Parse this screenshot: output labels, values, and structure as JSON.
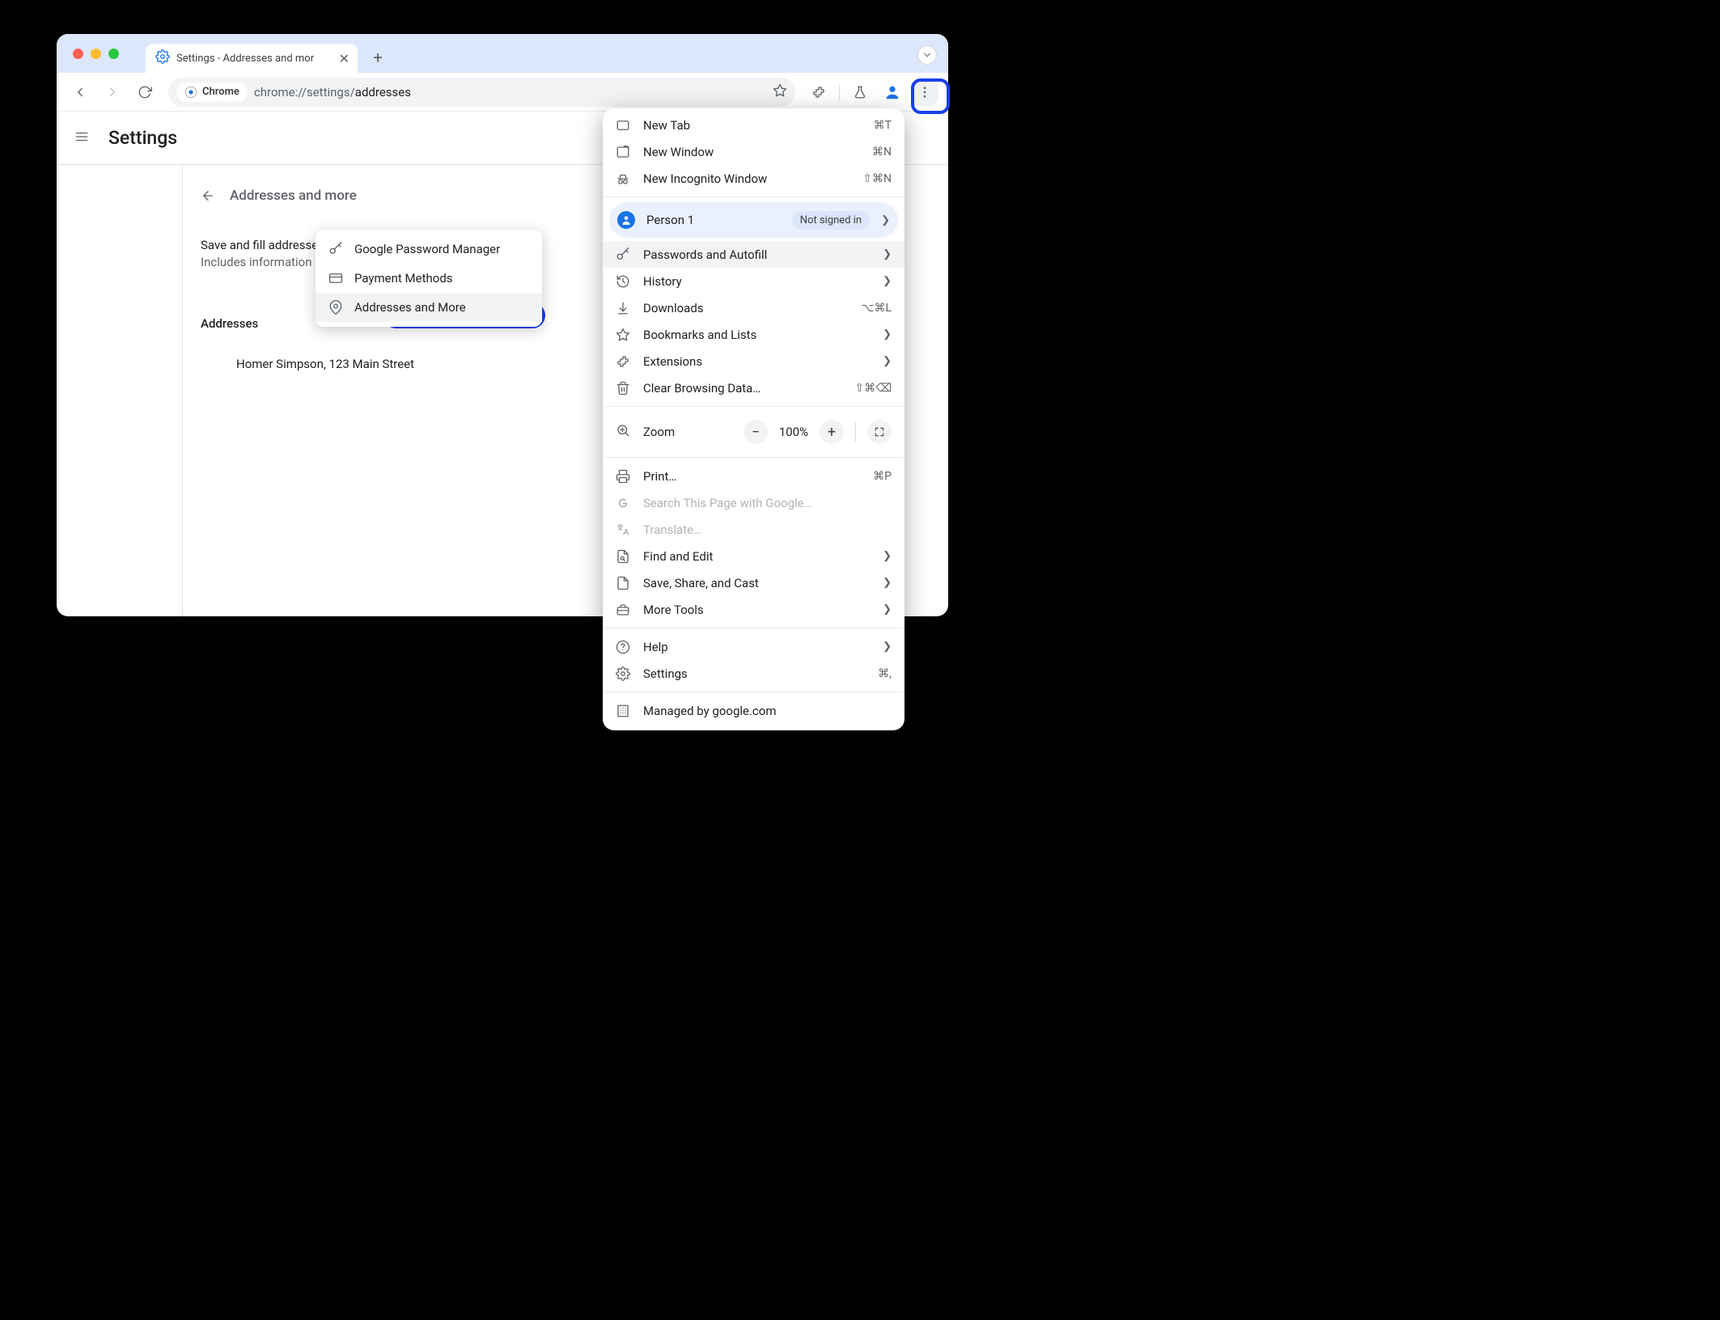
{
  "tab": {
    "title": "Settings - Addresses and mor"
  },
  "toolbar": {
    "chip": "Chrome",
    "url_base": "chrome://settings/",
    "url_path": "addresses"
  },
  "header": {
    "settings": "Settings"
  },
  "page": {
    "back_label": "Addresses and more",
    "save_title": "Save and fill addresses",
    "save_sub": "Includes information like phon",
    "addresses_label": "Addresses",
    "address_entry": "Homer Simpson, 123 Main Street"
  },
  "submenu": {
    "items": [
      {
        "label": "Google Password Manager"
      },
      {
        "label": "Payment Methods"
      },
      {
        "label": "Addresses and More"
      }
    ]
  },
  "menu": {
    "new_tab": "New Tab",
    "new_tab_sc": "⌘T",
    "new_window": "New Window",
    "new_window_sc": "⌘N",
    "incognito": "New Incognito Window",
    "incognito_sc": "⇧⌘N",
    "profile_name": "Person 1",
    "profile_badge": "Not signed in",
    "passwords": "Passwords and Autofill",
    "history": "History",
    "downloads": "Downloads",
    "downloads_sc": "⌥⌘L",
    "bookmarks": "Bookmarks and Lists",
    "extensions": "Extensions",
    "clear": "Clear Browsing Data…",
    "clear_sc": "⇧⌘⌫",
    "zoom": "Zoom",
    "zoom_value": "100%",
    "print": "Print…",
    "print_sc": "⌘P",
    "search_page": "Search This Page with Google…",
    "translate": "Translate…",
    "find": "Find and Edit",
    "save_share": "Save, Share, and Cast",
    "more_tools": "More Tools",
    "help": "Help",
    "settings": "Settings",
    "settings_sc": "⌘,",
    "managed": "Managed by google.com"
  }
}
